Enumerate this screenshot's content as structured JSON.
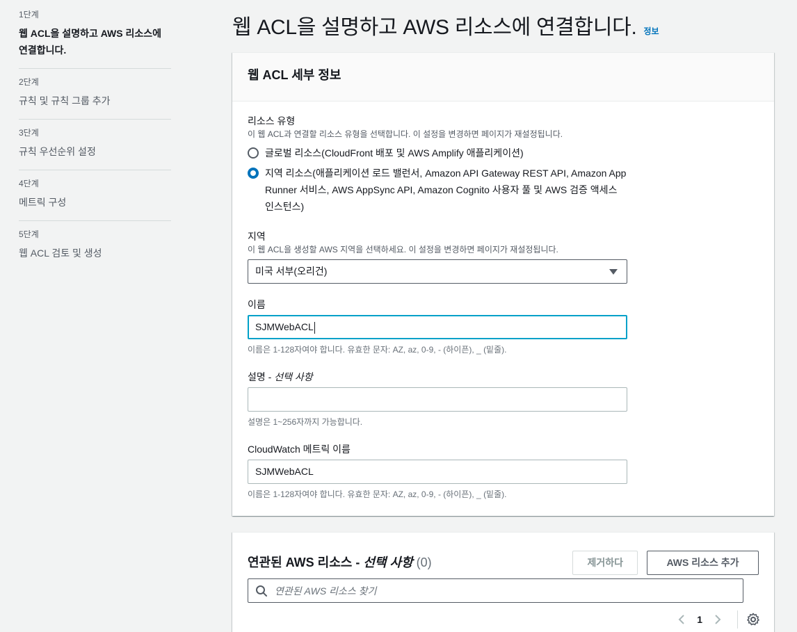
{
  "steps": [
    {
      "num": "1단계",
      "title": "웹 ACL을 설명하고 AWS 리소스에 연결합니다.",
      "active": true
    },
    {
      "num": "2단계",
      "title": "규칙 및 규칙 그룹 추가"
    },
    {
      "num": "3단계",
      "title": "규칙 우선순위 설정"
    },
    {
      "num": "4단계",
      "title": "메트릭 구성"
    },
    {
      "num": "5단계",
      "title": "웹 ACL 검토 및 생성"
    }
  ],
  "header": {
    "title": "웹 ACL을 설명하고 AWS 리소스에 연결합니다.",
    "info": "정보"
  },
  "details": {
    "heading": "웹 ACL 세부 정보",
    "resource_type": {
      "label": "리소스 유형",
      "description": "이 웹 ACL과 연결할 리소스 유형을 선택합니다. 이 설정을 변경하면 페이지가 재설정됩니다.",
      "options": [
        {
          "label": "글로벌 리소스(CloudFront 배포 및 AWS Amplify 애플리케이션)",
          "checked": false
        },
        {
          "label": "지역 리소스(애플리케이션 로드 밸런서, Amazon API Gateway REST API, Amazon App Runner 서비스, AWS AppSync API, Amazon Cognito 사용자 풀 및 AWS 검증 액세스 인스턴스)",
          "checked": true
        }
      ]
    },
    "region": {
      "label": "지역",
      "description": "이 웹 ACL을 생성할 AWS 지역을 선택하세요. 이 설정을 변경하면 페이지가 재설정됩니다.",
      "value": "미국 서부(오리건)"
    },
    "name": {
      "label": "이름",
      "value": "SJMWebACL",
      "hint": "이름은 1-128자여야 합니다. 유효한 문자: AZ, az, 0-9, - (하이픈), _ (밑줄)."
    },
    "description": {
      "label": "설명",
      "label_optional": "선택 사항",
      "value": "",
      "hint": "설명은 1~256자까지 가능합니다."
    },
    "metric": {
      "label": "CloudWatch 메트릭 이름",
      "value": "SJMWebACL",
      "hint": "이름은 1-128자여야 합니다. 유효한 문자: AZ, az, 0-9, - (하이픈), _ (밑줄)."
    }
  },
  "resources": {
    "title": "연관된 AWS 리소스",
    "title_optional": "선택 사항",
    "count": "(0)",
    "remove_label": "제거하다",
    "add_label": "AWS 리소스 추가",
    "search_placeholder": "연관된 AWS 리소스 찾기",
    "page": "1"
  }
}
